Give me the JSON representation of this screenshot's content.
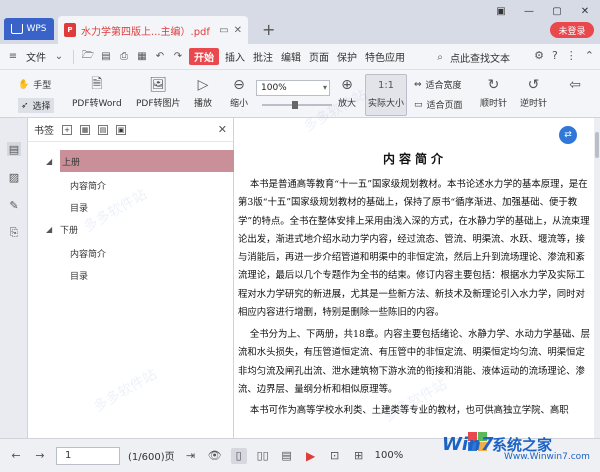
{
  "app": {
    "name": "WPS",
    "doc_tab_title": "水力学第四版上...主编）.pdf",
    "login": "未登录",
    "new_tab": "+"
  },
  "menu": {
    "file": "文件",
    "start": "开始",
    "items": [
      "插入",
      "批注",
      "编辑",
      "页面",
      "保护",
      "特色应用"
    ],
    "search": "点此查找文本"
  },
  "ribbon": {
    "hand": "手型",
    "select": "选择",
    "pdf_to_word": "PDF转Word",
    "pdf_to_image": "PDF转图片",
    "play": "播放",
    "zoom_out": "缩小",
    "zoom_value": "100%",
    "zoom_in": "放大",
    "actual_size": "实际大小",
    "fit_width": "适合宽度",
    "fit_page": "适合页面",
    "clockwise": "顺时针",
    "counterclockwise": "逆时针"
  },
  "bookmarks": {
    "title": "书签",
    "items": [
      {
        "label": "上册",
        "level": 0,
        "selected": true
      },
      {
        "label": "内容简介",
        "level": 1,
        "selected": false
      },
      {
        "label": "目录",
        "level": 1,
        "selected": false
      },
      {
        "label": "下册",
        "level": 0,
        "selected": false
      },
      {
        "label": "内容简介",
        "level": 1,
        "selected": false
      },
      {
        "label": "目录",
        "level": 1,
        "selected": false
      }
    ]
  },
  "page": {
    "title": "内容简介",
    "paragraphs": [
      "    本书是普通高等教育“十一五”国家级规划教材。本书论述水力学的基本原理，是在第3版“十五”国家级规划教材的基础上，保持了原书“循序渐进、加强基础、便于教学”的特点。全书在整体安排上采用由浅入深的方式，在水静力学的基础上，从流束理论出发，渐进式地介绍水动力学内容，经过流态、管流、明渠流、水跃、堰流等，接与消能后，再进一步介绍管道和明渠中的非恒定流，然后上升到流场理论、渗流和紊流理论，最后以几个专题作为全书的结束。修订内容主要包括：根据水力学及实际工程对水力学研究的新进展，尤其是一些新方法、新技术及新理论引入水力学，同时对相应内容进行增删，特别是删除一些陈旧的内容。",
      "    全书分为上、下两册，共18章。内容主要包括绪论、水静力学、水动力学基础、层流和水头损失，有压管道恒定流、有压管中的非恒定流、明渠恒定均匀流、明渠恒定非均匀流及闸孔出流、泄水建筑物下游水流的衔接和消能、液体运动的流场理论、渗流、边界层、量纲分析和相似原理等。",
      "    本书可作为高等学校水利类、土建类等专业的教材，也可供高独立学院、高职"
    ]
  },
  "status": {
    "page_input": "1",
    "page_total": "(1/600)页",
    "zoom_pct": "100%"
  },
  "brand": {
    "logo": "Win7",
    "name": "系统之家",
    "url": "Www.Winwin7.com"
  },
  "watermark_text": "多多软件站"
}
